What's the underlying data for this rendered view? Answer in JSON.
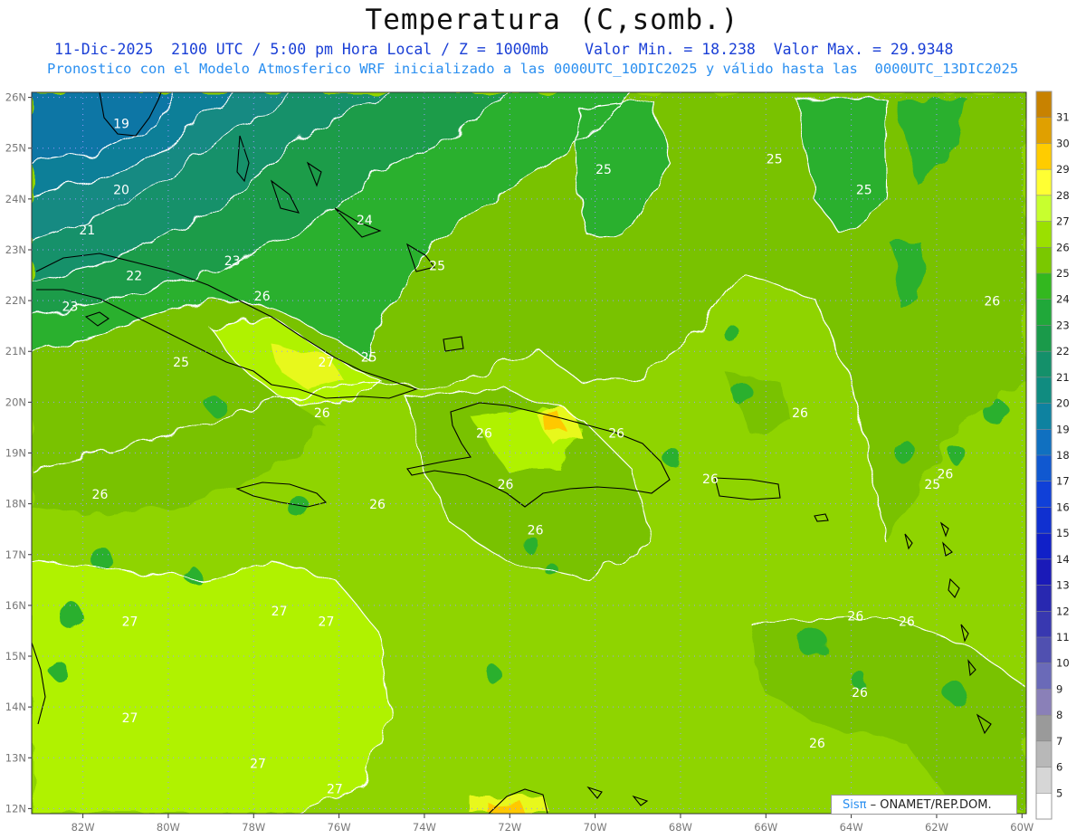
{
  "title": "Temperatura (C,somb.)",
  "subtitle_line1": "11-Dic-2025  2100 UTC / 5:00 pm Hora Local / Z = 1000mb    Valor Min. = 18.238  Valor Max. = 29.9348",
  "subtitle_line2": "Pronostico con el Modelo Atmosferico WRF inicializado a las 0000UTC_10DIC2025 y válido hasta las  0000UTC_13DIC2025",
  "credit": {
    "brand": "Sisπ",
    "rest": " – ONAMET/REP.DOM."
  },
  "map": {
    "lon_range": [
      -83.2,
      -59.9
    ],
    "lat_range": [
      11.9,
      26.1
    ],
    "lon_ticks": [
      "82W",
      "80W",
      "78W",
      "76W",
      "74W",
      "72W",
      "70W",
      "68W",
      "66W",
      "64W",
      "62W",
      "60W"
    ],
    "lat_ticks": [
      "26N",
      "25N",
      "24N",
      "23N",
      "22N",
      "21N",
      "20N",
      "19N",
      "18N",
      "17N",
      "16N",
      "15N",
      "14N",
      "13N",
      "12N"
    ],
    "contour_labels": [
      {
        "text": "19",
        "lon": -81.1,
        "lat": 25.4
      },
      {
        "text": "20",
        "lon": -81.1,
        "lat": 24.1
      },
      {
        "text": "21",
        "lon": -81.9,
        "lat": 23.3
      },
      {
        "text": "22",
        "lon": -80.8,
        "lat": 22.4
      },
      {
        "text": "23",
        "lon": -82.3,
        "lat": 21.8
      },
      {
        "text": "23",
        "lon": -78.5,
        "lat": 22.7
      },
      {
        "text": "24",
        "lon": -75.4,
        "lat": 23.5
      },
      {
        "text": "25",
        "lon": -73.7,
        "lat": 22.6
      },
      {
        "text": "25",
        "lon": -79.7,
        "lat": 20.7
      },
      {
        "text": "25",
        "lon": -69.8,
        "lat": 24.5
      },
      {
        "text": "25",
        "lon": -65.8,
        "lat": 24.7
      },
      {
        "text": "25",
        "lon": -63.7,
        "lat": 24.1
      },
      {
        "text": "25",
        "lon": -62.1,
        "lat": 18.3
      },
      {
        "text": "25",
        "lon": -75.3,
        "lat": 20.8
      },
      {
        "text": "26",
        "lon": -77.8,
        "lat": 22.0
      },
      {
        "text": "26",
        "lon": -76.4,
        "lat": 19.7
      },
      {
        "text": "26",
        "lon": -81.6,
        "lat": 18.1
      },
      {
        "text": "26",
        "lon": -75.1,
        "lat": 17.9
      },
      {
        "text": "26",
        "lon": -72.6,
        "lat": 19.3
      },
      {
        "text": "26",
        "lon": -72.1,
        "lat": 18.3
      },
      {
        "text": "26",
        "lon": -71.4,
        "lat": 17.4
      },
      {
        "text": "26",
        "lon": -69.5,
        "lat": 19.3
      },
      {
        "text": "26",
        "lon": -67.3,
        "lat": 18.4
      },
      {
        "text": "26",
        "lon": -65.2,
        "lat": 19.7
      },
      {
        "text": "26",
        "lon": -61.8,
        "lat": 18.5
      },
      {
        "text": "26",
        "lon": -60.7,
        "lat": 21.9
      },
      {
        "text": "26",
        "lon": -63.9,
        "lat": 15.7
      },
      {
        "text": "26",
        "lon": -62.7,
        "lat": 15.6
      },
      {
        "text": "26",
        "lon": -63.8,
        "lat": 14.2
      },
      {
        "text": "26",
        "lon": -64.8,
        "lat": 13.2
      },
      {
        "text": "27",
        "lon": -76.3,
        "lat": 20.7
      },
      {
        "text": "27",
        "lon": -80.9,
        "lat": 15.6
      },
      {
        "text": "27",
        "lon": -77.4,
        "lat": 15.8
      },
      {
        "text": "27",
        "lon": -76.3,
        "lat": 15.6
      },
      {
        "text": "27",
        "lon": -80.9,
        "lat": 13.7
      },
      {
        "text": "27",
        "lon": -77.9,
        "lat": 12.8
      },
      {
        "text": "27",
        "lon": -76.1,
        "lat": 12.3
      }
    ]
  },
  "colorbar": {
    "labels": [
      "31",
      "30",
      "29",
      "28",
      "27",
      "26",
      "25",
      "24",
      "23",
      "22",
      "21",
      "20",
      "19",
      "18",
      "17",
      "16",
      "15",
      "14",
      "13",
      "12",
      "11",
      "10",
      "9",
      "8",
      "7",
      "6",
      "5"
    ],
    "colors": [
      "#c88200",
      "#e0a000",
      "#ffcc00",
      "#ffff33",
      "#c8ff2e",
      "#9be000",
      "#7ac800",
      "#33b81f",
      "#20a83a",
      "#1a9a4a",
      "#14906a",
      "#108c80",
      "#0e82a0",
      "#1070c0",
      "#1058d0",
      "#1040d8",
      "#1030d0",
      "#1020c8",
      "#1a1ab8",
      "#2828b0",
      "#3838b0",
      "#5050b0",
      "#6a6ab8",
      "#8a80b8",
      "#9a9a9a",
      "#b8b8b8",
      "#d6d6d6",
      "#ffffff"
    ]
  }
}
